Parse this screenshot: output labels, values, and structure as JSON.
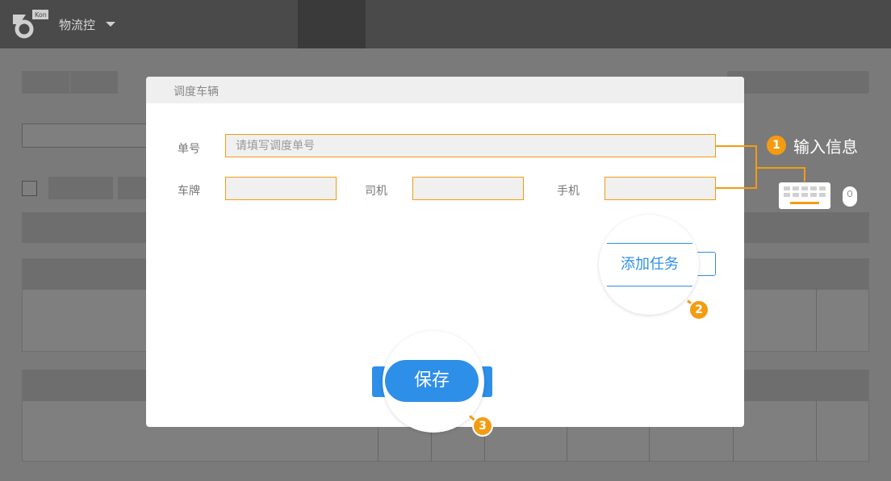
{
  "app": {
    "name": "物流控"
  },
  "modal": {
    "title": "调度车辆",
    "fields": {
      "order_label": "单号",
      "order_placeholder": "请填写调度单号",
      "plate_label": "车牌",
      "driver_label": "司机",
      "phone_label": "手机"
    },
    "add_task_label": "添加任务",
    "save_label": "保存"
  },
  "annotations": {
    "step1_number": "1",
    "step1_text": "输入信息",
    "step2_number": "2",
    "step3_number": "3",
    "icons": [
      "keyboard-icon",
      "mouse-icon"
    ]
  },
  "colors": {
    "accent": "#f39c12",
    "primary": "#2e8fe8",
    "topbar": "#4a4a4a"
  }
}
